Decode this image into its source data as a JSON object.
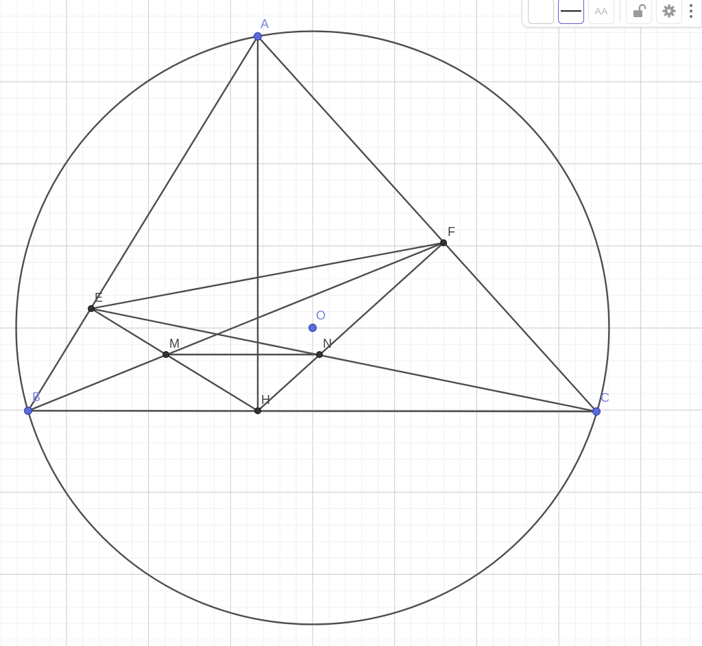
{
  "toolbar": {
    "text_style_label": "AA",
    "buttons": [
      "color-button",
      "line-style-button",
      "text-style-button",
      "lock-button",
      "settings-button",
      "more-menu-button"
    ]
  },
  "colors": {
    "free_point": "#5d6bd8",
    "free_point_label": "#7b84e0",
    "dependent_point": "#333333",
    "dependent_label": "#444444",
    "segment": "#4d4d4d",
    "grid_major": "#c8c8c8",
    "grid_minor": "#ececec"
  },
  "points": [
    {
      "label": "A",
      "kind": "free"
    },
    {
      "label": "B",
      "kind": "free"
    },
    {
      "label": "C",
      "kind": "free"
    },
    {
      "label": "O",
      "kind": "free"
    },
    {
      "label": "E",
      "kind": "dependent"
    },
    {
      "label": "F",
      "kind": "dependent"
    },
    {
      "label": "H",
      "kind": "dependent"
    },
    {
      "label": "M",
      "kind": "dependent"
    },
    {
      "label": "N",
      "kind": "dependent"
    }
  ],
  "segments": [
    [
      "A",
      "B"
    ],
    [
      "A",
      "C"
    ],
    [
      "B",
      "C"
    ],
    [
      "A",
      "H"
    ],
    [
      "E",
      "F"
    ],
    [
      "E",
      "C"
    ],
    [
      "E",
      "H"
    ],
    [
      "B",
      "F"
    ],
    [
      "F",
      "H"
    ],
    [
      "M",
      "N"
    ]
  ],
  "circles": [
    {
      "center": "O",
      "through": "A"
    }
  ]
}
